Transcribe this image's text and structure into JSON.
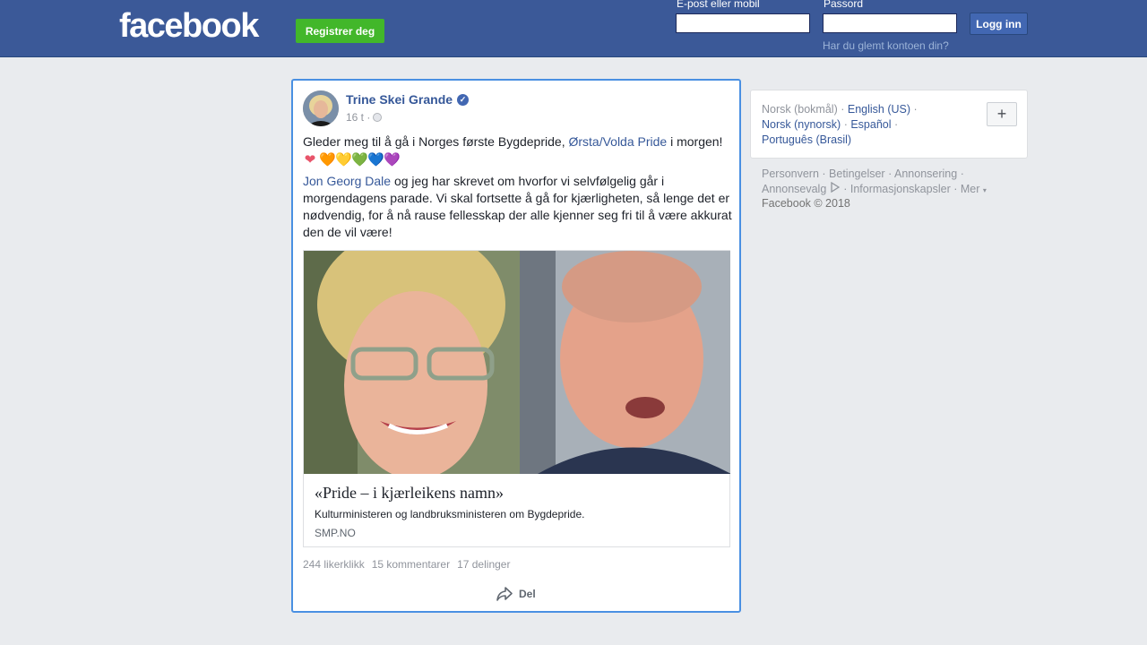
{
  "header": {
    "logo": "facebook",
    "register_label": "Registrer deg",
    "email_label": "E-post eller mobil",
    "password_label": "Passord",
    "login_label": "Logg inn",
    "forgot_label": "Har du glemt kontoen din?"
  },
  "post": {
    "author": "Trine Skei Grande",
    "time": "16 t ·",
    "line1_pre": "Gleder meg til å gå i Norges første Bygdepride, ",
    "line1_link": "Ørsta/Volda Pride",
    "line1_post": " i morgen!",
    "hearts": [
      "❤",
      "🧡",
      "💛",
      "💚",
      "💙",
      "💜"
    ],
    "para2_link": "Jon Georg Dale",
    "para2_text": " og jeg har skrevet om hvorfor vi selvfølgelig går i morgendagens parade. Vi skal fortsette å gå for kjærligheten, så lenge det er nødvendig, for å nå rause fellesskap der alle kjenner seg fri til å være akkurat den de vil være!",
    "link_title": "«Pride – i kjærleikens namn»",
    "link_desc": "Kulturministeren og landbruksministeren om Bygdepride.",
    "link_domain": "SMP.NO",
    "likes": "244 likerklikk",
    "comments": "15 kommentarer",
    "shares": "17 delinger",
    "share_label": "Del"
  },
  "languages": {
    "current": "Norsk (bokmål)",
    "items": [
      "English (US)",
      "Norsk (nynorsk)",
      "Español",
      "Português (Brasil)"
    ]
  },
  "footer": {
    "links": [
      "Personvern",
      "Betingelser",
      "Annonsering",
      "Annonsevalg",
      "Informasjonskapsler",
      "Mer"
    ],
    "copyright": "Facebook © 2018"
  }
}
